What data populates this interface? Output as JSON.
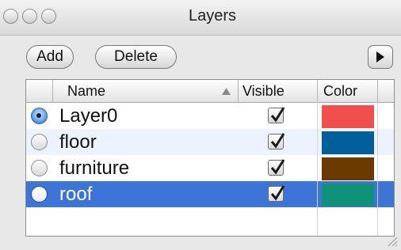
{
  "window": {
    "title": "Layers"
  },
  "toolbar": {
    "add_label": "Add",
    "delete_label": "Delete"
  },
  "table": {
    "columns": {
      "name": "Name",
      "visible": "Visible",
      "color": "Color"
    },
    "sort_indicator": "ascending",
    "rows": [
      {
        "name": "Layer0",
        "active": true,
        "selected": false,
        "visible": true,
        "color": "#f04f4e"
      },
      {
        "name": "floor",
        "active": false,
        "selected": false,
        "visible": true,
        "color": "#035f9b"
      },
      {
        "name": "furniture",
        "active": false,
        "selected": false,
        "visible": true,
        "color": "#6b3a00"
      },
      {
        "name": "roof",
        "active": false,
        "selected": true,
        "visible": true,
        "color": "#10927a"
      }
    ]
  },
  "colors": {
    "selection": "#3d74d6",
    "alt_row": "#edf3fe"
  }
}
